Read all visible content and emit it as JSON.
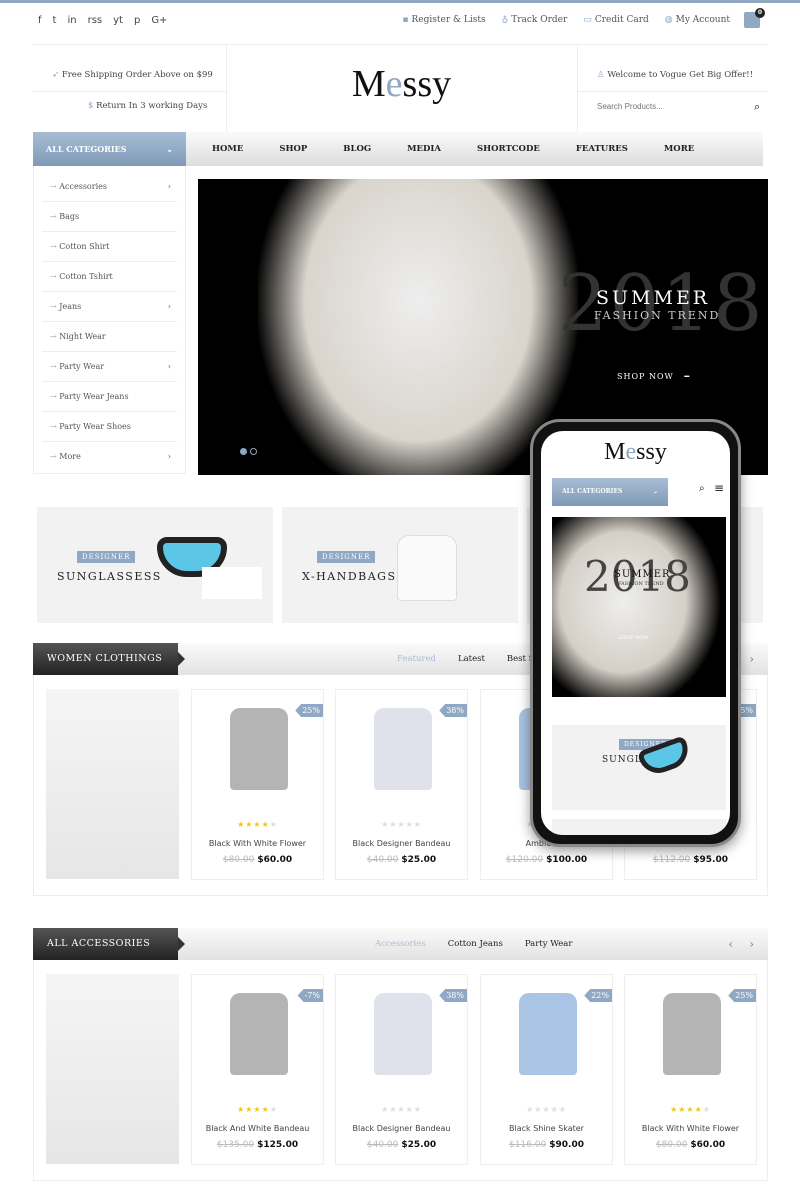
{
  "topbar": {
    "social": [
      "f",
      "t",
      "in",
      "rss",
      "yt",
      "p",
      "G+"
    ],
    "links": [
      {
        "icon": "gift-icon",
        "label": "Register & Lists"
      },
      {
        "icon": "map-pin-icon",
        "label": "Track Order"
      },
      {
        "icon": "credit-card-icon",
        "label": "Credit Card"
      },
      {
        "icon": "globe-icon",
        "label": "My Account"
      }
    ],
    "cart_count": "0"
  },
  "header": {
    "shipping": "Free Shipping Order Above on $99",
    "returns": "Return In 3 working Days",
    "logo_m": "M",
    "logo_e": "e",
    "logo_rest": "ssy",
    "welcome": "Welcome to Vogue Get Big Offer!!",
    "search_placeholder": "Search Products..."
  },
  "nav": {
    "categories_label": "ALL CATEGORIES",
    "menu": [
      "HOME",
      "SHOP",
      "BLOG",
      "MEDIA",
      "SHORTCODE",
      "FEATURES",
      "MORE"
    ]
  },
  "sidebar": [
    {
      "label": "Accessories",
      "sub": true
    },
    {
      "label": "Bags",
      "sub": false
    },
    {
      "label": "Cotton Shirt",
      "sub": false
    },
    {
      "label": "Cotton Tshirt",
      "sub": false
    },
    {
      "label": "Jeans",
      "sub": true
    },
    {
      "label": "Night Wear",
      "sub": false
    },
    {
      "label": "Party Wear",
      "sub": true
    },
    {
      "label": "Party Wear Jeans",
      "sub": false
    },
    {
      "label": "Party Wear Shoes",
      "sub": false
    },
    {
      "label": "More",
      "sub": true
    }
  ],
  "banner": {
    "year": "2018",
    "title": "SUMMER",
    "subtitle": "FASHION TREND",
    "cta": "SHOP NOW"
  },
  "promos": [
    {
      "tag": "DESIGNER",
      "title": "SUNGLASSESS"
    },
    {
      "tag": "DESIGNER",
      "title": "X-HANDBAGS"
    }
  ],
  "section1": {
    "title": "WOMEN CLOTHINGS",
    "tabs": [
      "Featured",
      "Latest",
      "Best S"
    ],
    "products": [
      {
        "name": "Black With White Flower",
        "old": "$80.00",
        "price": "$60.00",
        "discount": "25%",
        "rating": 4
      },
      {
        "name": "Black Designer Bandeau",
        "old": "$40.00",
        "price": "$25.00",
        "discount": "38%",
        "rating": 0
      },
      {
        "name": "Ambient B",
        "old": "$120.00",
        "price": "$100.00",
        "discount": "",
        "rating": 0
      },
      {
        "name": "lack",
        "old": "$112.00",
        "price": "$95.00",
        "discount": "5%",
        "rating": 0
      }
    ]
  },
  "section2": {
    "title": "ALL ACCESSORIES",
    "tabs": [
      "Accessories",
      "Cotton Jeans",
      "Party Wear"
    ],
    "products": [
      {
        "name": "Black And White Bandeau",
        "old": "$135.00",
        "price": "$125.00",
        "discount": "-7%",
        "rating": 4
      },
      {
        "name": "Black Designer Bandeau",
        "old": "$40.00",
        "price": "$25.00",
        "discount": "38%",
        "rating": 0
      },
      {
        "name": "Black Shine Skater",
        "old": "$116.00",
        "price": "$90.00",
        "discount": "22%",
        "rating": 0
      },
      {
        "name": "Black With White Flower",
        "old": "$80.00",
        "price": "$60.00",
        "discount": "25%",
        "rating": 4
      }
    ]
  },
  "phone": {
    "logo_m": "M",
    "logo_e": "e",
    "logo_rest": "ssy",
    "categories_label": "ALL CATEGORIES",
    "year": "2018",
    "title": "SUMMER",
    "subtitle": "FASHION TREND",
    "cta": "SHOP NOW",
    "promo_tag": "DESIGNER",
    "promo_title": "SUNGLASSESS"
  },
  "colors": {
    "accent": "#8fa8c4",
    "dark": "#333333",
    "star": "#f3c614"
  }
}
